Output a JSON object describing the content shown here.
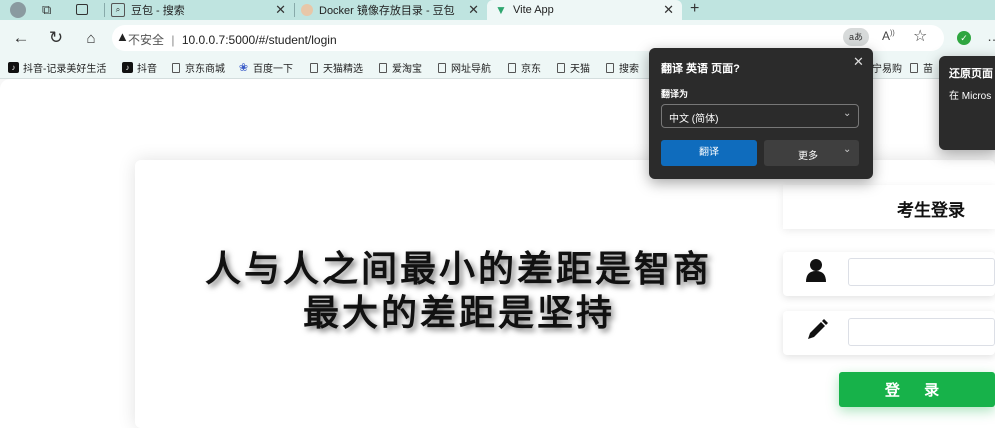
{
  "browser": {
    "tabs": [
      {
        "title": "豆包 - 搜索",
        "icon": "search-icon"
      },
      {
        "title": "Docker 镜像存放目录 - 豆包",
        "icon": "doubao-icon"
      },
      {
        "title": "Vite App",
        "icon": "vue-icon",
        "active": true
      }
    ],
    "new_tab": "+",
    "address": {
      "security_label": "不安全",
      "separator": "|",
      "url": "10.0.0.7:5000/#/student/login"
    },
    "bookmarks": [
      {
        "label": "抖音-记录美好生活",
        "icon": "tiktok-icon"
      },
      {
        "label": "抖音",
        "icon": "tiktok-icon"
      },
      {
        "label": "京东商城",
        "icon": "document-icon"
      },
      {
        "label": "百度一下",
        "icon": "baidu-icon"
      },
      {
        "label": "天猫精选",
        "icon": "document-icon"
      },
      {
        "label": "爱淘宝",
        "icon": "document-icon"
      },
      {
        "label": "网址导航",
        "icon": "document-icon"
      },
      {
        "label": "京东",
        "icon": "document-icon"
      },
      {
        "label": "天猫",
        "icon": "document-icon"
      },
      {
        "label": "搜索",
        "icon": "document-icon"
      },
      {
        "label": "宁易购",
        "icon": "document-icon"
      },
      {
        "label": "苗",
        "icon": "document-icon"
      }
    ]
  },
  "translate_popup": {
    "title": "翻译 英语 页面?",
    "translate_to_label": "翻译为",
    "language": "中文 (简体)",
    "translate_button": "翻译",
    "more_button": "更多"
  },
  "restore_popup": {
    "title": "还原页面",
    "body": "在 Micros"
  },
  "page": {
    "motto_line1": "人与人之间最小的差距是智商",
    "motto_line2": "最大的差距是坚持",
    "login_title": "考生登录",
    "username_value": "",
    "password_value": "",
    "login_button": "登 录"
  },
  "colors": {
    "tab_strip": "#bfe4e0",
    "toolbar": "#eef7f6",
    "login_button": "#17b24a",
    "popup_bg": "#2b2b2b",
    "popup_primary": "#0f6cbd"
  }
}
